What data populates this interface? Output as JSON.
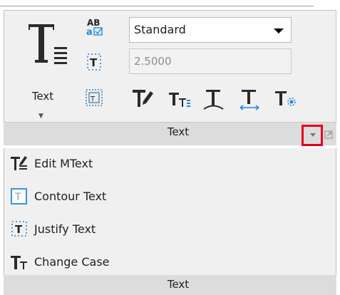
{
  "panel": {
    "title": "Text",
    "big_button_label": "Text",
    "style_combo_value": "Standard",
    "height_field_value": "2.5000"
  },
  "dropdown": {
    "items": [
      {
        "label": "Edit MText",
        "icon": "edit-mtext-icon"
      },
      {
        "label": "Contour Text",
        "icon": "contour-text-icon"
      },
      {
        "label": "Justify Text",
        "icon": "justify-text-icon"
      },
      {
        "label": "Change Case",
        "icon": "change-case-icon"
      }
    ],
    "footer_label": "Text"
  },
  "colors": {
    "highlight_border": "#e6001e",
    "accent_blue": "#1e88e5"
  }
}
